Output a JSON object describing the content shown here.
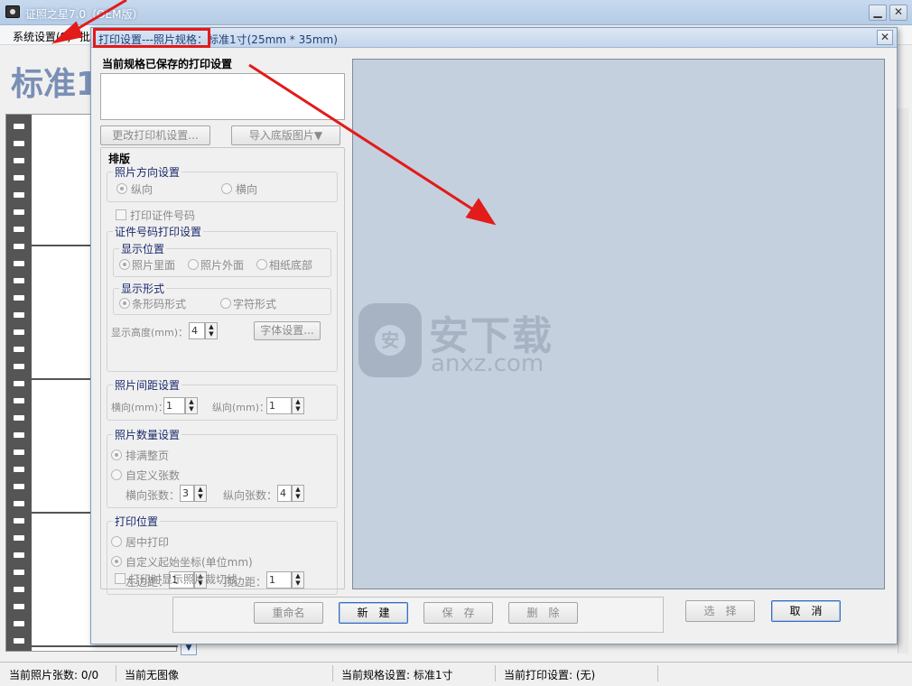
{
  "app": {
    "title": "证照之星7.0（OEM版）",
    "menu": [
      "系统设置(S)",
      "批"
    ],
    "big_title": "标准1"
  },
  "dialog": {
    "title": "打印设置---照片规格：标准1寸(25mm * 35mm)",
    "saved_label": "当前规格已保存的打印设置",
    "change_printer": "更改打印机设置...",
    "import_bg": "导入底版图片▼",
    "layout_caption": "排版",
    "orientation": {
      "label": "照片方向设置",
      "portrait": "纵向",
      "landscape": "横向"
    },
    "print_id_number": "打印证件号码",
    "id_print": {
      "label": "证件号码打印设置",
      "position_label": "显示位置",
      "inside": "照片里面",
      "outside": "照片外面",
      "paper_bottom": "相纸底部",
      "form_label": "显示形式",
      "barcode": "条形码形式",
      "text": "字符形式",
      "height_label": "显示高度(mm)：",
      "height_value": "4",
      "font_button": "字体设置..."
    },
    "spacing": {
      "label": "照片间距设置",
      "h_label": "横向(mm)：",
      "h_value": "1",
      "v_label": "纵向(mm)：",
      "v_value": "1"
    },
    "count": {
      "label": "照片数量设置",
      "fill_page": "排满整页",
      "custom": "自定义张数",
      "h_count_label": "横向张数：",
      "h_count_value": "3",
      "v_count_label": "纵向张数：",
      "v_count_value": "4"
    },
    "position": {
      "label": "打印位置",
      "center": "居中打印",
      "custom": "自定义起始坐标(单位mm)",
      "left_label": "左边距：",
      "left_value": "1",
      "top_label": "顶边距：",
      "top_value": "1"
    },
    "show_cut_lines": "打印时显示照片裁切线",
    "buttons": {
      "rename": "重命名",
      "new": "新　建",
      "save": "保　存",
      "delete": "删　除",
      "select": "选　择",
      "cancel": "取　消"
    },
    "watermark": {
      "text": "安下载",
      "url": "anxz.com"
    }
  },
  "status": {
    "count": "当前照片张数: 0/0",
    "image": "当前无图像",
    "spec": "当前规格设置: 标准1寸",
    "print": "当前打印设置: (无)"
  },
  "colors": {
    "accent": "#e21b1b",
    "preview_bg": "#c4d0de",
    "title_text": "#1b3f78"
  }
}
